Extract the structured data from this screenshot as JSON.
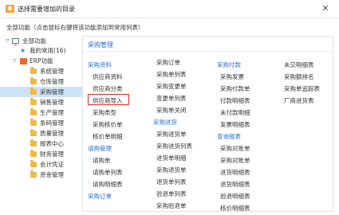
{
  "window": {
    "title": "选择需要增加的目录",
    "close_glyph": "✕"
  },
  "hint": "全部功能（点击鼠标右键将该功能添加到常用列表）",
  "tree": {
    "root_label": "全部功能",
    "favorites_label": "我的常用(16)",
    "erp_label": "ERP功能",
    "modules": [
      "系统管理",
      "仓库管理",
      "采购管理",
      "销售管理",
      "生产管理",
      "条码管理",
      "质量管理",
      "报表中心",
      "财务管理",
      "会计凭证",
      "资金管理"
    ],
    "selected": "采购管理"
  },
  "panel": {
    "title": "采购管理",
    "groups": {
      "purchase_data": "采购资料",
      "request_mgmt": "请购管理",
      "purchase_order": "采购订单",
      "purchase_receive": "采购进货",
      "purchase_payment": "采购付款",
      "query_report": "查询报表"
    },
    "col1_top": [
      "供应商资料",
      "供应商分类",
      "供应商导入",
      "采购类型",
      "采购核价单",
      "核价单明细"
    ],
    "col1_mid": [
      "请购单",
      "请购单列表",
      "请购明细表"
    ],
    "col2_top": [
      "采购订单",
      "采购单列表",
      "采购变更单",
      "变更单列表",
      "采购单关闭"
    ],
    "col2_mid": [
      "采购进货单",
      "采购进货列表",
      "进货单明细",
      "采购退货单",
      "退货单列表",
      "验退单列表",
      "采购验退单"
    ],
    "col3_top": [
      "采购发票",
      "采购付款单",
      "付款明细表",
      "未付款明细",
      "发票明细表"
    ],
    "col3_mid": [
      "采购对账单",
      "采购对账单",
      "进货明细表",
      "退货明细表",
      "验退明细表",
      "核价明细表"
    ],
    "col4": [
      "未交明细表",
      "采购额排名",
      "采购单追踪表",
      "厂商进货表"
    ]
  },
  "colors": {
    "accent": "#2b6fc6",
    "selected_bg": "#cde3f7",
    "highlight_border": "#e02727",
    "folder": "#f0b849"
  }
}
